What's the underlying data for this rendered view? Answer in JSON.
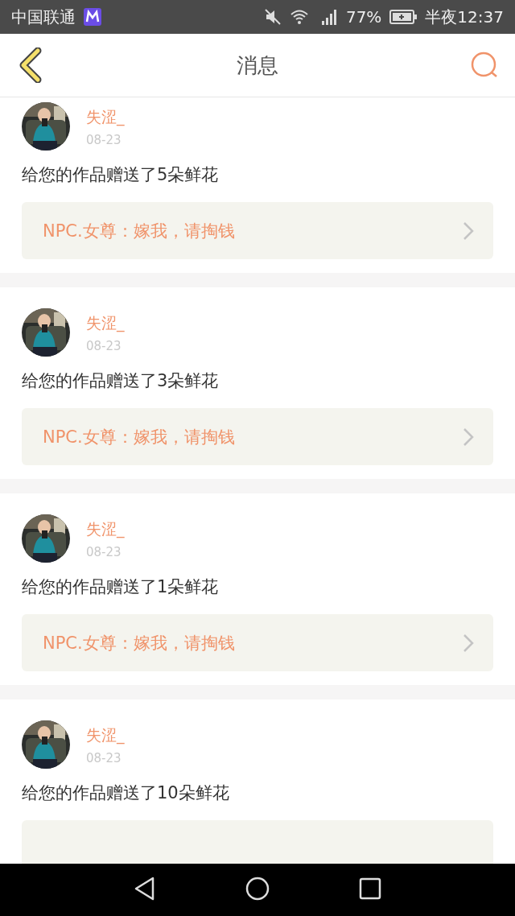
{
  "status_bar": {
    "carrier": "中国联通",
    "battery": "77%",
    "time": "半夜12:37"
  },
  "header": {
    "title": "消息"
  },
  "messages": [
    {
      "user": "失涩_",
      "date": "08-23",
      "text": "给您的作品赠送了5朵鲜花",
      "quote": "NPC.女尊：嫁我，请掏钱"
    },
    {
      "user": "失涩_",
      "date": "08-23",
      "text": "给您的作品赠送了3朵鲜花",
      "quote": "NPC.女尊：嫁我，请掏钱"
    },
    {
      "user": "失涩_",
      "date": "08-23",
      "text": "给您的作品赠送了1朵鲜花",
      "quote": "NPC.女尊：嫁我，请掏钱"
    },
    {
      "user": "失涩_",
      "date": "08-23",
      "text": "给您的作品赠送了10朵鲜花"
    }
  ]
}
